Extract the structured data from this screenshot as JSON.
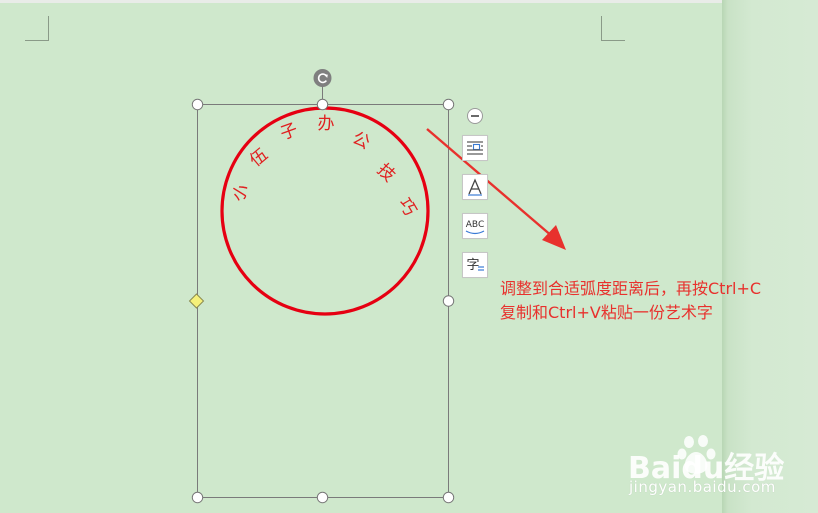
{
  "document": {
    "background": "#cfe8cc"
  },
  "wordart": {
    "characters": [
      "小",
      "伍",
      "子",
      "办",
      "公",
      "技",
      "巧"
    ],
    "text_color": "#e02020",
    "circle_color": "#e60012"
  },
  "side_toolbar": {
    "collapse_icon": "minus-circle-icon",
    "tools": [
      {
        "name": "layout-options",
        "icon": "text-wrap-icon"
      },
      {
        "name": "shape-style",
        "icon": "text-outline-icon"
      },
      {
        "name": "text-effect",
        "icon": "wordart-abc-icon",
        "label": "ABC"
      },
      {
        "name": "text-fill",
        "icon": "character-fill-icon",
        "label": "字"
      }
    ]
  },
  "annotation": {
    "line1": "调整到合适弧度距离后，再按Ctrl+C",
    "line2": "复制和Ctrl+V粘贴一份艺术字",
    "color": "#e8312d"
  },
  "watermark": {
    "brand": "Baidu经验",
    "url": "jingyan.baidu.com"
  }
}
